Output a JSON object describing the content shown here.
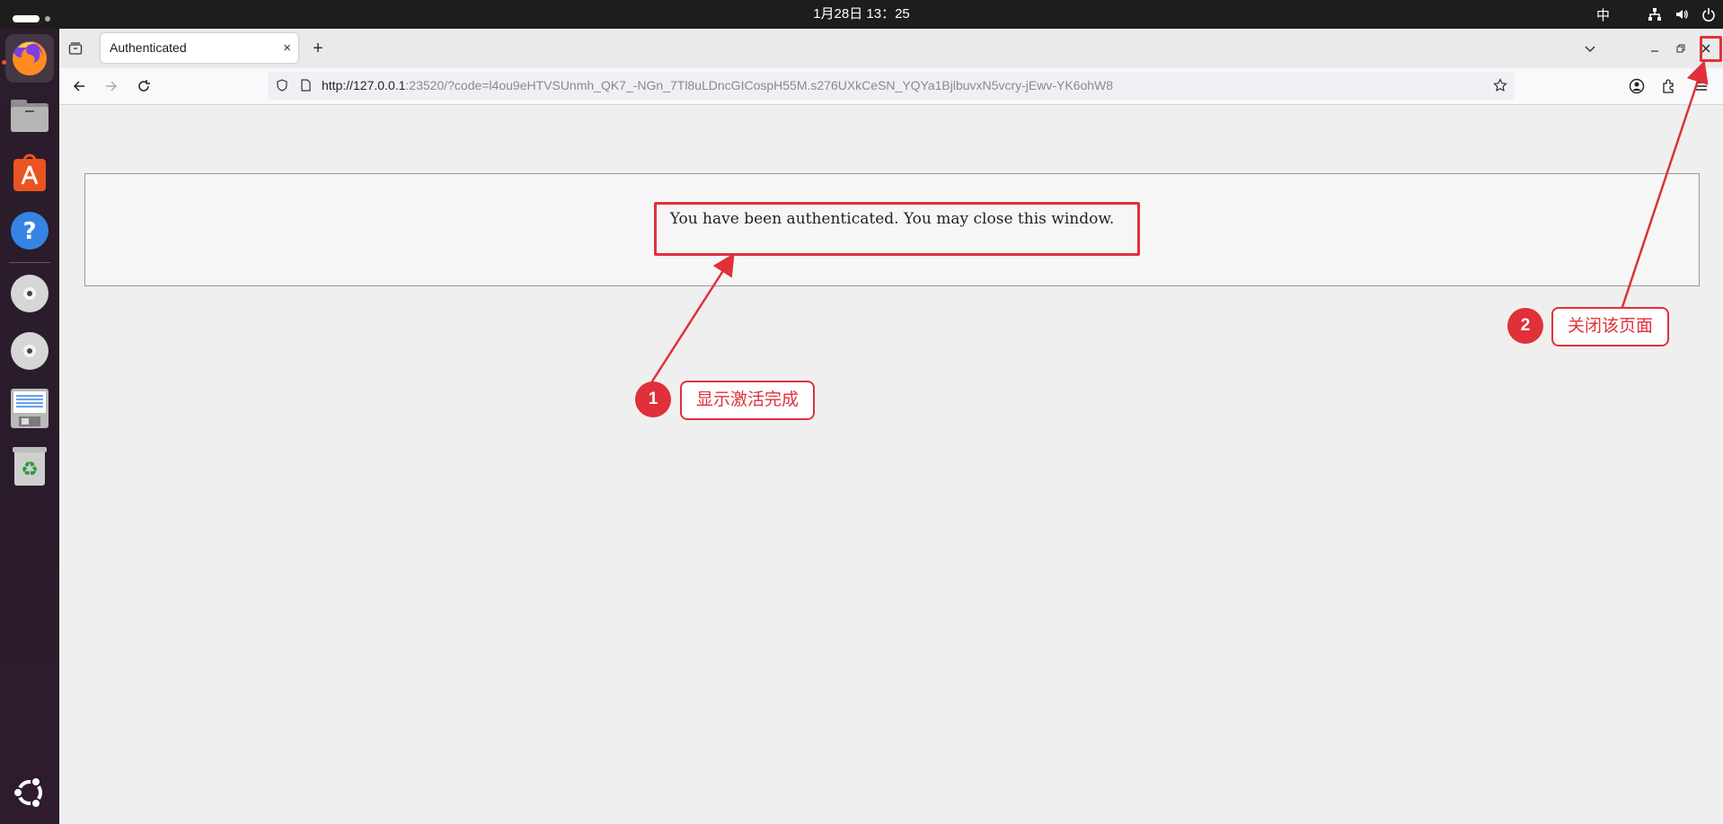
{
  "system_bar": {
    "clock": "1月28日  13：25",
    "input_method": "中"
  },
  "dock": {
    "items": [
      "firefox-icon",
      "files-icon",
      "app-center-icon",
      "help-icon",
      "disc-icon",
      "disc-icon",
      "text-editor-icon",
      "trash-icon",
      "ubuntu-logo-icon"
    ]
  },
  "browser": {
    "tab_title": "Authenticated",
    "tab_close": "×",
    "new_tab": "+",
    "url_host": "http://127.0.0.1",
    "url_rest": ":23520/?code=l4ou9eHTVSUnmh_QK7_-NGn_7Tl8uLDncGICospH55M.s276UXkCeSN_YQYa1BjlbuvxN5vcry-jEwv-YK6ohW8"
  },
  "page": {
    "message": "You have been authenticated. You may close this window."
  },
  "annotations": {
    "step1_number": "1",
    "step1_label": "显示激活完成",
    "step2_number": "2",
    "step2_label": "关闭该页面",
    "color": "#e0303a"
  }
}
